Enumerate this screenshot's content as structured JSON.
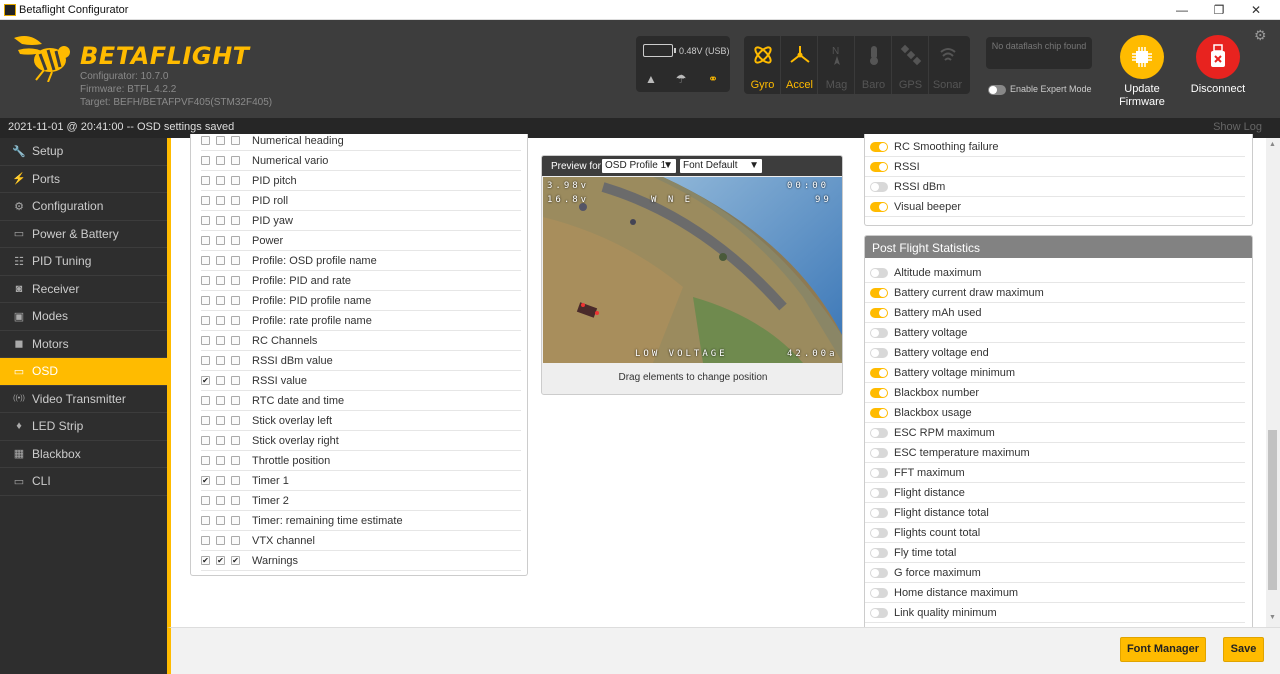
{
  "window": {
    "title": "Betaflight Configurator",
    "minimize": "—",
    "maximize": "❐",
    "close": "✕"
  },
  "header": {
    "logo": "BETAFLIGHT",
    "configurator": "Configurator: 10.7.0",
    "firmware": "Firmware: BTFL 4.2.2",
    "target": "Target: BEFH/BETAFPVF405(STM32F405)",
    "battery": "0.48V (USB)",
    "sensors": [
      {
        "label": "Gyro",
        "active": true
      },
      {
        "label": "Accel",
        "active": true
      },
      {
        "label": "Mag",
        "active": false
      },
      {
        "label": "Baro",
        "active": false
      },
      {
        "label": "GPS",
        "active": false
      },
      {
        "label": "Sonar",
        "active": false
      }
    ],
    "dataflash": "No dataflash chip found",
    "expert_mode": "Enable Expert Mode",
    "update_firmware": "Update Firmware",
    "disconnect": "Disconnect"
  },
  "status": {
    "message": "2021-11-01 @ 20:41:00 -- OSD settings saved",
    "show_log": "Show Log"
  },
  "nav": [
    {
      "label": "Setup",
      "icon": "wrench-icon",
      "glyph": "🔧"
    },
    {
      "label": "Ports",
      "icon": "plug-icon",
      "glyph": "⚡"
    },
    {
      "label": "Configuration",
      "icon": "gear-icon",
      "glyph": "⚙"
    },
    {
      "label": "Power & Battery",
      "icon": "battery-icon",
      "glyph": "▭"
    },
    {
      "label": "PID Tuning",
      "icon": "sliders-icon",
      "glyph": "☷"
    },
    {
      "label": "Receiver",
      "icon": "receiver-icon",
      "glyph": "◙"
    },
    {
      "label": "Modes",
      "icon": "modes-icon",
      "glyph": "▣"
    },
    {
      "label": "Motors",
      "icon": "motor-icon",
      "glyph": "◼"
    },
    {
      "label": "OSD",
      "icon": "osd-icon",
      "glyph": "▭",
      "active": true
    },
    {
      "label": "Video Transmitter",
      "icon": "antenna-icon",
      "glyph": "((•))"
    },
    {
      "label": "LED Strip",
      "icon": "led-icon",
      "glyph": "♦"
    },
    {
      "label": "Blackbox",
      "icon": "blackbox-icon",
      "glyph": "▦"
    },
    {
      "label": "CLI",
      "icon": "terminal-icon",
      "glyph": "▭"
    }
  ],
  "elements": [
    {
      "name": "Numerical heading",
      "checks": [
        false,
        false,
        false
      ]
    },
    {
      "name": "Numerical vario",
      "checks": [
        false,
        false,
        false
      ]
    },
    {
      "name": "PID pitch",
      "checks": [
        false,
        false,
        false
      ]
    },
    {
      "name": "PID roll",
      "checks": [
        false,
        false,
        false
      ]
    },
    {
      "name": "PID yaw",
      "checks": [
        false,
        false,
        false
      ]
    },
    {
      "name": "Power",
      "checks": [
        false,
        false,
        false
      ]
    },
    {
      "name": "Profile: OSD profile name",
      "checks": [
        false,
        false,
        false
      ]
    },
    {
      "name": "Profile: PID and rate",
      "checks": [
        false,
        false,
        false
      ]
    },
    {
      "name": "Profile: PID profile name",
      "checks": [
        false,
        false,
        false
      ]
    },
    {
      "name": "Profile: rate profile name",
      "checks": [
        false,
        false,
        false
      ]
    },
    {
      "name": "RC Channels",
      "checks": [
        false,
        false,
        false
      ]
    },
    {
      "name": "RSSI dBm value",
      "checks": [
        false,
        false,
        false
      ]
    },
    {
      "name": "RSSI value",
      "checks": [
        true,
        false,
        false
      ]
    },
    {
      "name": "RTC date and time",
      "checks": [
        false,
        false,
        false
      ]
    },
    {
      "name": "Stick overlay left",
      "checks": [
        false,
        false,
        false
      ]
    },
    {
      "name": "Stick overlay right",
      "checks": [
        false,
        false,
        false
      ]
    },
    {
      "name": "Throttle position",
      "checks": [
        false,
        false,
        false
      ]
    },
    {
      "name": "Timer 1",
      "checks": [
        true,
        false,
        false
      ]
    },
    {
      "name": "Timer 2",
      "checks": [
        false,
        false,
        false
      ]
    },
    {
      "name": "Timer: remaining time estimate",
      "checks": [
        false,
        false,
        false
      ]
    },
    {
      "name": "VTX channel",
      "checks": [
        false,
        false,
        false
      ]
    },
    {
      "name": "Warnings",
      "checks": [
        true,
        true,
        true
      ]
    }
  ],
  "preview": {
    "label": "Preview for",
    "profile": "OSD Profile 1",
    "font": "Font Default",
    "footer": "Drag elements to change position",
    "osd": {
      "volt1": "3.98v",
      "volt2": "16.8v",
      "compass": "W   N   E",
      "timer": "00:00",
      "rssi": "99",
      "warning": "LOW VOLTAGE",
      "mah": "42.00a"
    }
  },
  "warnings": [
    {
      "name": "RC Smoothing failure",
      "on": true
    },
    {
      "name": "RSSI",
      "on": true
    },
    {
      "name": "RSSI dBm",
      "on": false
    },
    {
      "name": "Visual beeper",
      "on": true
    }
  ],
  "stats": {
    "title": "Post Flight Statistics",
    "items": [
      {
        "name": "Altitude maximum",
        "on": false
      },
      {
        "name": "Battery current draw maximum",
        "on": true
      },
      {
        "name": "Battery mAh used",
        "on": true
      },
      {
        "name": "Battery voltage",
        "on": false
      },
      {
        "name": "Battery voltage end",
        "on": false
      },
      {
        "name": "Battery voltage minimum",
        "on": true
      },
      {
        "name": "Blackbox number",
        "on": true
      },
      {
        "name": "Blackbox usage",
        "on": true
      },
      {
        "name": "ESC RPM maximum",
        "on": false
      },
      {
        "name": "ESC temperature maximum",
        "on": false
      },
      {
        "name": "FFT maximum",
        "on": false
      },
      {
        "name": "Flight distance",
        "on": false
      },
      {
        "name": "Flight distance total",
        "on": false
      },
      {
        "name": "Flights count total",
        "on": false
      },
      {
        "name": "Fly time total",
        "on": false
      },
      {
        "name": "G force maximum",
        "on": false
      },
      {
        "name": "Home distance maximum",
        "on": false
      },
      {
        "name": "Link quality minimum",
        "on": false
      }
    ]
  },
  "footer": {
    "font_manager": "Font Manager",
    "save": "Save"
  },
  "colors": {
    "accent": "#ffbb00",
    "header_bg": "#3d3d3d",
    "sidebar_bg": "#2e2e2e",
    "disconnect": "#e8231f"
  }
}
